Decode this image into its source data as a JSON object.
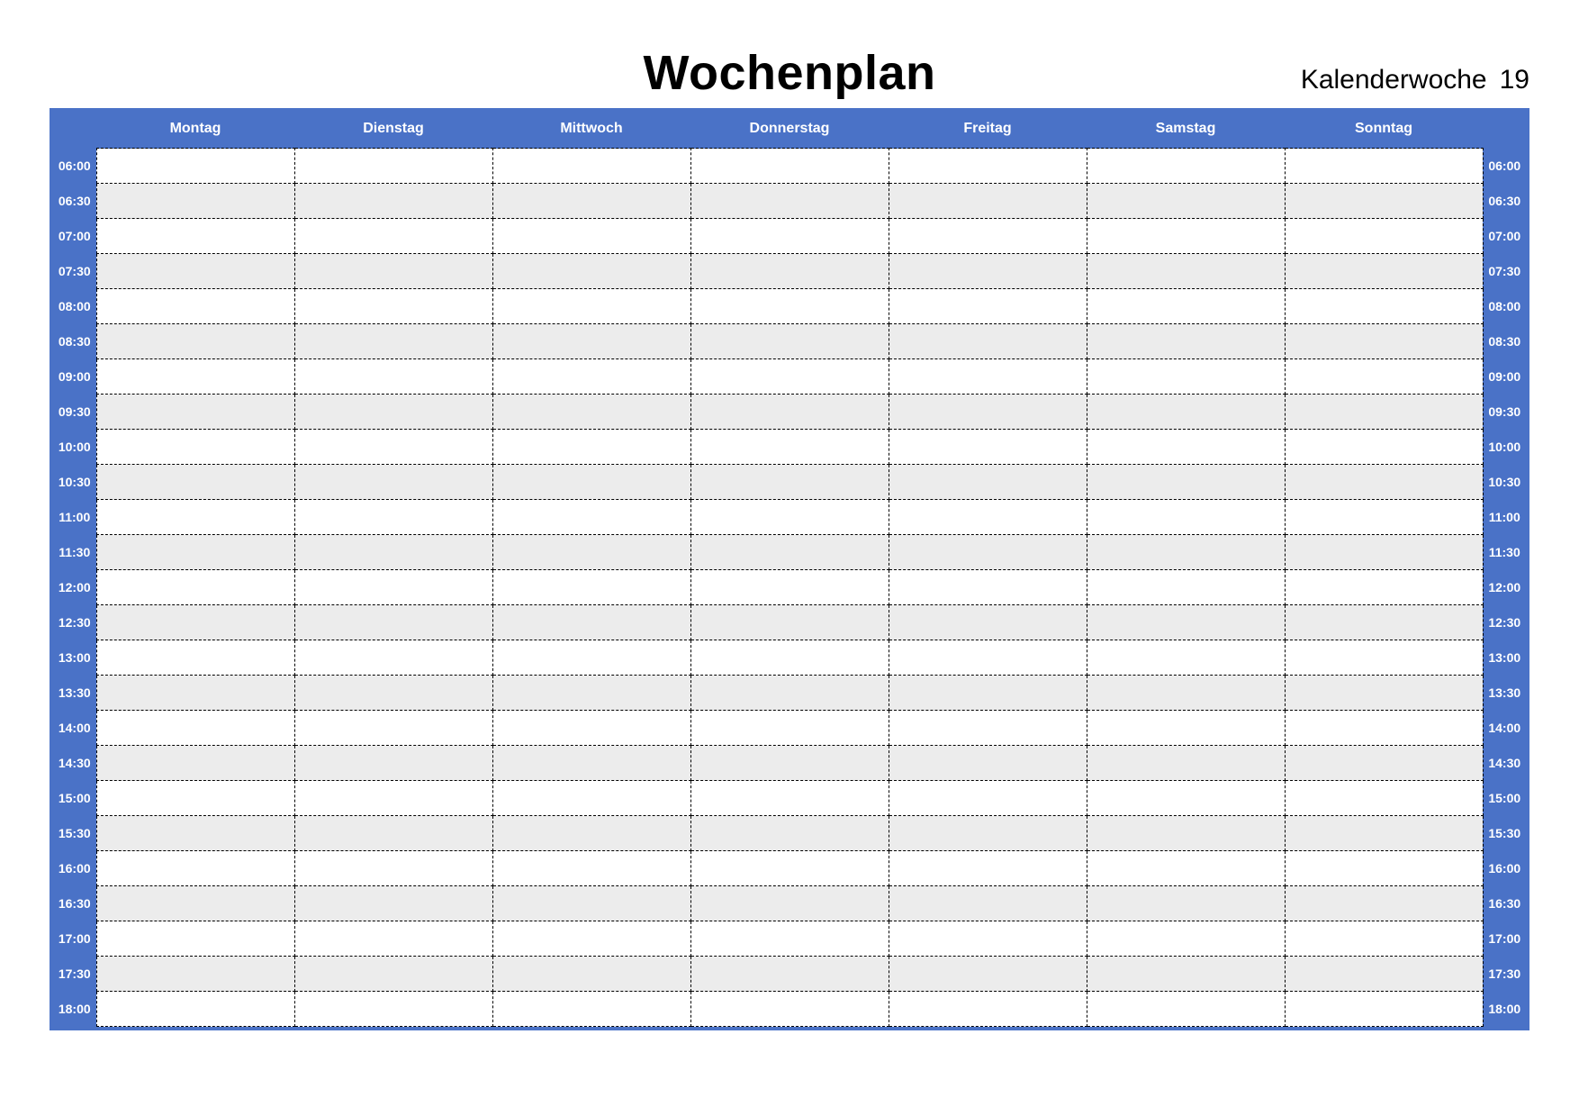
{
  "header": {
    "title": "Wochenplan",
    "week_label": "Kalenderwoche",
    "week_number": "19"
  },
  "days": [
    "Montag",
    "Dienstag",
    "Mittwoch",
    "Donnerstag",
    "Freitag",
    "Samstag",
    "Sonntag"
  ],
  "times": [
    "06:00",
    "06:30",
    "07:00",
    "07:30",
    "08:00",
    "08:30",
    "09:00",
    "09:30",
    "10:00",
    "10:30",
    "11:00",
    "11:30",
    "12:00",
    "12:30",
    "13:00",
    "13:30",
    "14:00",
    "14:30",
    "15:00",
    "15:30",
    "16:00",
    "16:30",
    "17:00",
    "17:30",
    "18:00"
  ],
  "colors": {
    "frame": "#4a72c7",
    "row_alt": "#ececec"
  }
}
